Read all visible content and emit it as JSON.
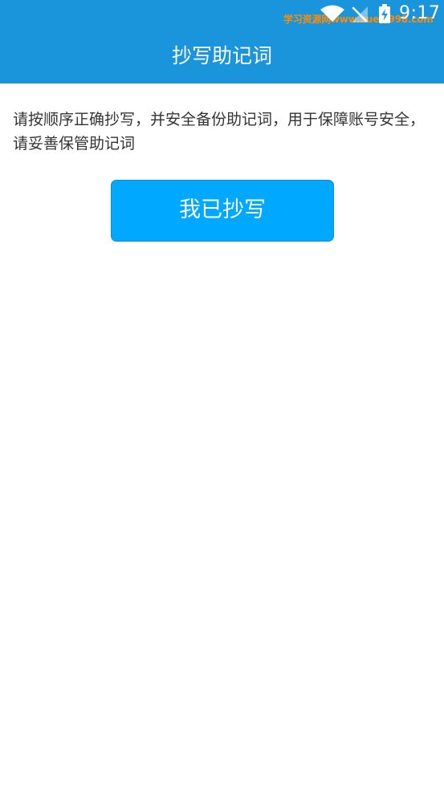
{
  "status_bar": {
    "watermark": "学习资源网www.xuexi998.com",
    "time": "9:17",
    "icons": [
      "wifi-icon",
      "no-sim-signal-icon",
      "battery-charging-icon"
    ]
  },
  "header": {
    "title": "抄写助记词"
  },
  "content": {
    "instruction": "请按顺序正确抄写，并安全备份助记词，用于保障账号安全，\n请妥善保管助记词"
  },
  "actions": {
    "confirm_label": "我已抄写"
  },
  "colors": {
    "header_bg": "#1a94db",
    "button_bg": "#00a8ff",
    "watermark": "#ff8c00"
  }
}
